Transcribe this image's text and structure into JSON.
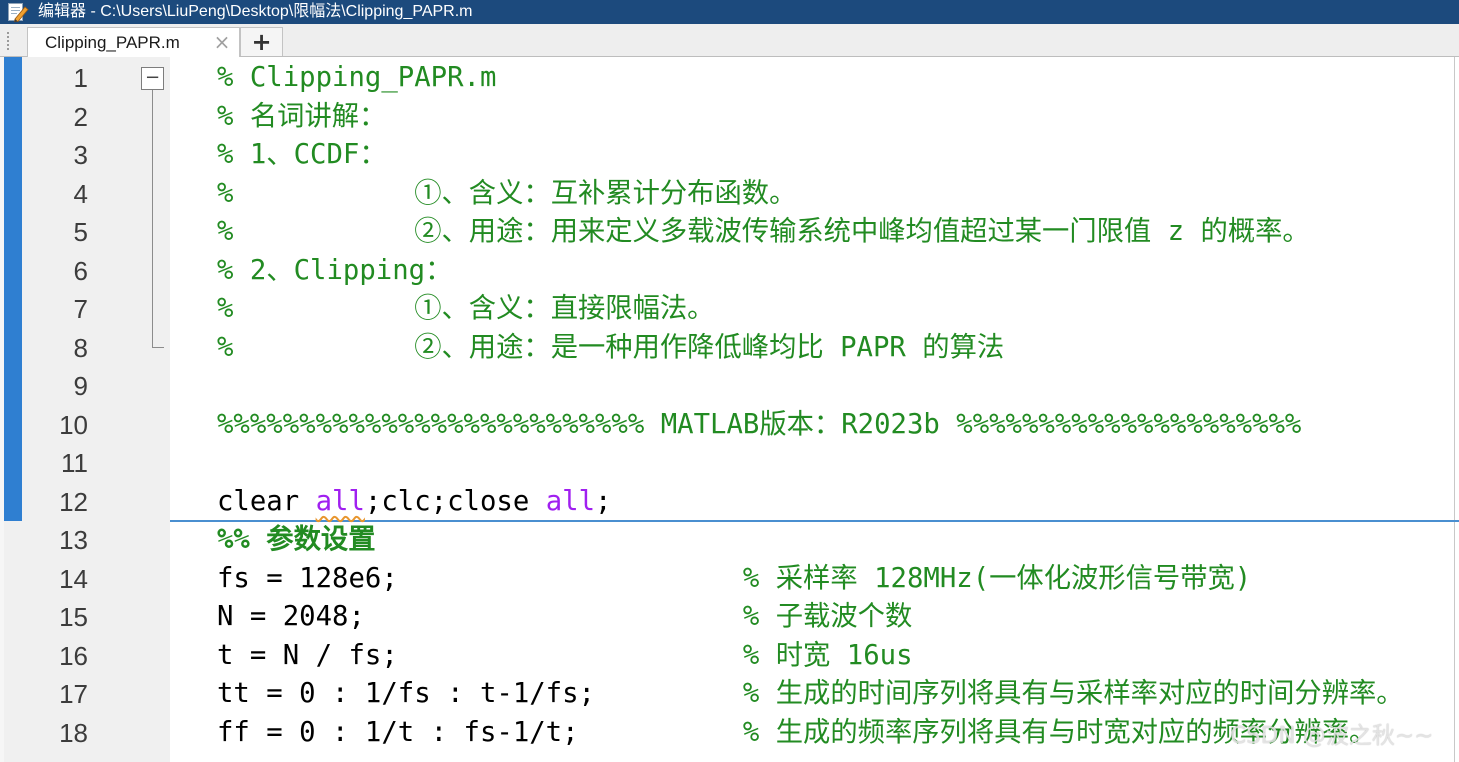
{
  "window": {
    "title": "编辑器 - C:\\Users\\LiuPeng\\Desktop\\限幅法\\Clipping_PAPR.m",
    "icon": "editor-icon"
  },
  "tab_bar": {
    "tabs": [
      {
        "label": "Clipping_PAPR.m",
        "close_icon": "close-icon",
        "close_glyph": "×",
        "active": true
      }
    ],
    "add_tab_icon": "plus-icon",
    "add_tab_glyph": "+"
  },
  "colors": {
    "title_bar": "#1c4a7d",
    "section_bar": "#2f7fd1",
    "section_line": "#4a8fd0",
    "comment": "#228b22",
    "string": "#a020f0",
    "code": "#000000",
    "line_number": "#3c3c3c",
    "warning_underline": "#e8962e"
  },
  "editor": {
    "fold_glyph": "−",
    "lines": [
      {
        "number": "1",
        "tokens": [
          {
            "comment": "% Clipping_PAPR.m"
          }
        ]
      },
      {
        "number": "2",
        "tokens": [
          {
            "comment": "% 名词讲解："
          }
        ]
      },
      {
        "number": "3",
        "tokens": [
          {
            "comment": "% 1、CCDF："
          }
        ]
      },
      {
        "number": "4",
        "tokens": [
          {
            "comment": "%           ①、含义：互补累计分布函数。"
          }
        ]
      },
      {
        "number": "5",
        "tokens": [
          {
            "comment": "%           ②、用途：用来定义多载波传输系统中峰均值超过某一门限值 z 的概率。"
          }
        ]
      },
      {
        "number": "6",
        "tokens": [
          {
            "comment": "% 2、Clipping："
          }
        ]
      },
      {
        "number": "7",
        "tokens": [
          {
            "comment": "%           ①、含义：直接限幅法。"
          }
        ]
      },
      {
        "number": "8",
        "tokens": [
          {
            "comment": "%           ②、用途：是一种用作降低峰均比 PAPR 的算法"
          }
        ]
      },
      {
        "number": "9",
        "tokens": []
      },
      {
        "number": "10",
        "tokens": [
          {
            "comment": "%%%%%%%%%%%%%%%%%%%%%%%%%% MATLAB版本：R2023b %%%%%%%%%%%%%%%%%%%%%"
          }
        ]
      },
      {
        "number": "11",
        "tokens": []
      },
      {
        "number": "12",
        "tokens": [
          {
            "code": "clear "
          },
          {
            "string": "all",
            "warning": true
          },
          {
            "code": ";clc;close "
          },
          {
            "string": "all"
          },
          {
            "code": ";"
          }
        ]
      },
      {
        "number": "13",
        "section_break": true,
        "tokens": [
          {
            "section": "%% 参数设置"
          }
        ]
      },
      {
        "number": "14",
        "tokens": [
          {
            "code": "fs = 128e6;"
          },
          {
            "comment": "% 采样率 128MHz(一体化波形信号带宽)"
          }
        ]
      },
      {
        "number": "15",
        "tokens": [
          {
            "code": "N = 2048;"
          },
          {
            "comment": "% 子载波个数"
          }
        ]
      },
      {
        "number": "16",
        "tokens": [
          {
            "code": "t = N / fs;"
          },
          {
            "comment": "% 时宽 16us"
          }
        ]
      },
      {
        "number": "17",
        "tokens": [
          {
            "code": "tt = 0 : 1/fs : t-1/fs;"
          },
          {
            "comment": "% 生成的时间序列将具有与采样率对应的时间分辨率。"
          }
        ]
      },
      {
        "number": "18",
        "tokens": [
          {
            "code": "ff = 0 : 1/t : fs-1/t;"
          },
          {
            "comment": "% 生成的频率序列将具有与时宽对应的频率分辨率。"
          }
        ]
      }
    ]
  },
  "watermark": "CSDN @波之秋~~"
}
